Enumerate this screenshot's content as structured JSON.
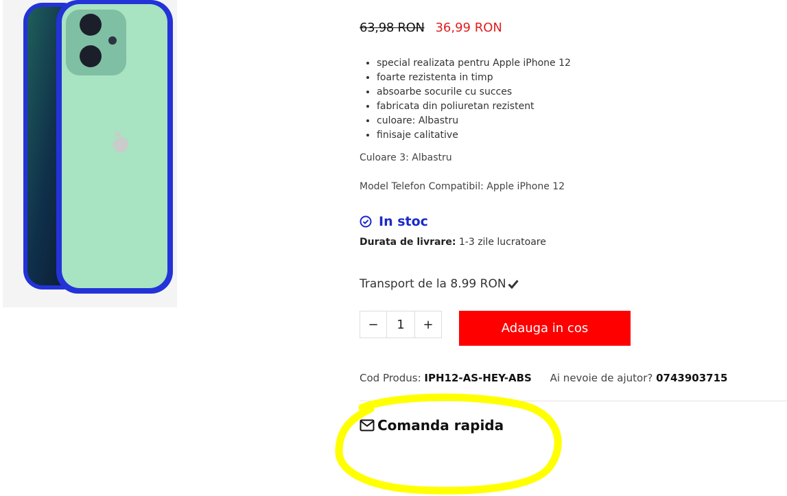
{
  "colors": {
    "accent_red": "#ff0000",
    "price_red": "#e01d1d",
    "stock_blue": "#1b29c8",
    "highlight_yellow": "#ffff00"
  },
  "product": {
    "image_icon": "phone-case-image",
    "price_old": "63,98 RON",
    "price_new": "36,99 RON",
    "features": [
      "special realizata pentru Apple iPhone 12",
      "foarte rezistenta in timp",
      "absoarbe socurile cu succes",
      "fabricata din poliuretan rezistent",
      "culoare: Albastru",
      "finisaje calitative"
    ],
    "color_prop": "Culoare 3: Albastru",
    "model_prop": "Model Telefon Compatibil: Apple iPhone 12",
    "stock_label": "In stoc",
    "delivery_label": "Durata de livrare:",
    "delivery_value": "1-3 zile lucratoare",
    "transport": "Transport de la 8.99 RON",
    "quantity": {
      "minus": "−",
      "value": "1",
      "plus": "+"
    },
    "add_to_cart": "Adauga in cos",
    "code_label": "Cod Produs:",
    "code_value": "IPH12-AS-HEY-ABS",
    "help_label": "Ai nevoie de ajutor?",
    "help_phone": "0743903715",
    "quick_order": "Comanda rapida"
  }
}
